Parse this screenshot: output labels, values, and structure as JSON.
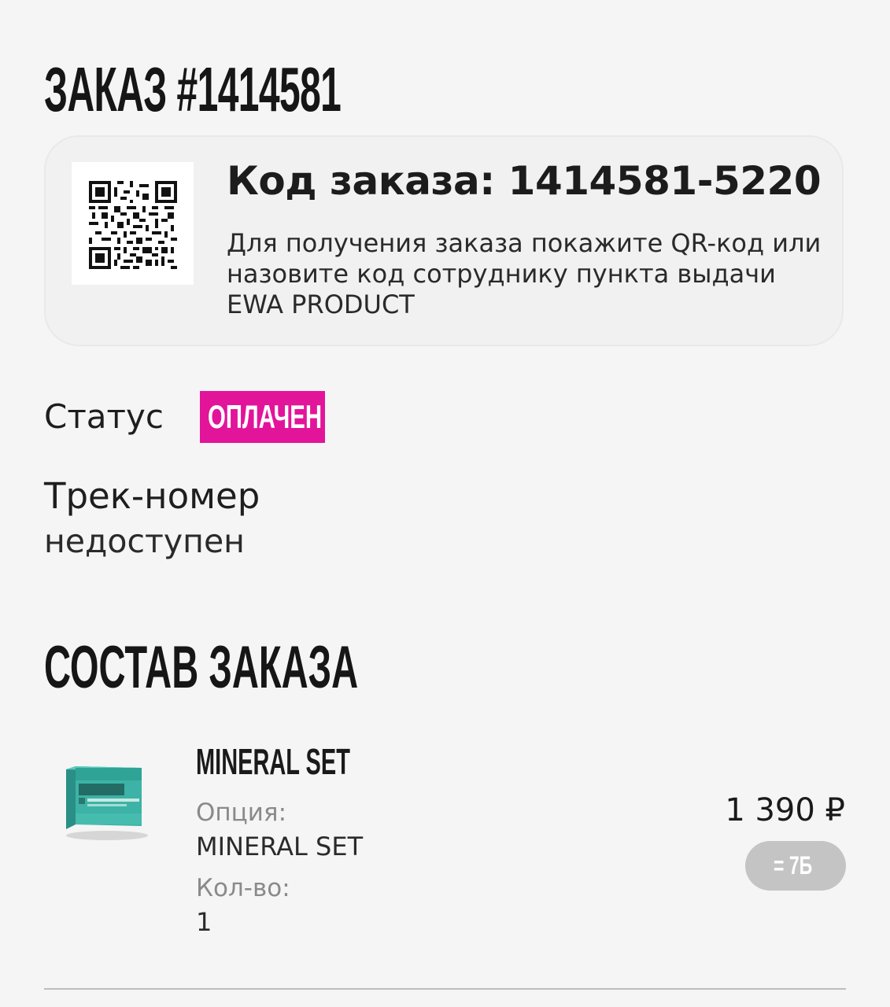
{
  "order": {
    "title": "ЗАКАЗ #1414581",
    "pickup": {
      "code_line": "Код заказа: 1414581-5220",
      "hint": "Для получения заказа покажите QR-код или назовите код сотруднику пункта выдачи EWA PRODUCT"
    },
    "status": {
      "label": "Статус",
      "value": "ОПЛАЧЕН",
      "color": "#e2149a"
    },
    "tracking": {
      "label": "Трек-номер",
      "value": "недоступен"
    }
  },
  "composition": {
    "title": "СОСТАВ ЗАКАЗА",
    "items": [
      {
        "name": "MINERAL SET",
        "image": "product-box-image",
        "option_label": "Опция:",
        "option_value": "MINERAL SET",
        "qty_label": "Кол-во:",
        "qty_value": "1",
        "price": "1 390 ₽",
        "bonus": "= 7Б"
      }
    ]
  },
  "icons": {
    "qr": "qr-code-icon"
  }
}
